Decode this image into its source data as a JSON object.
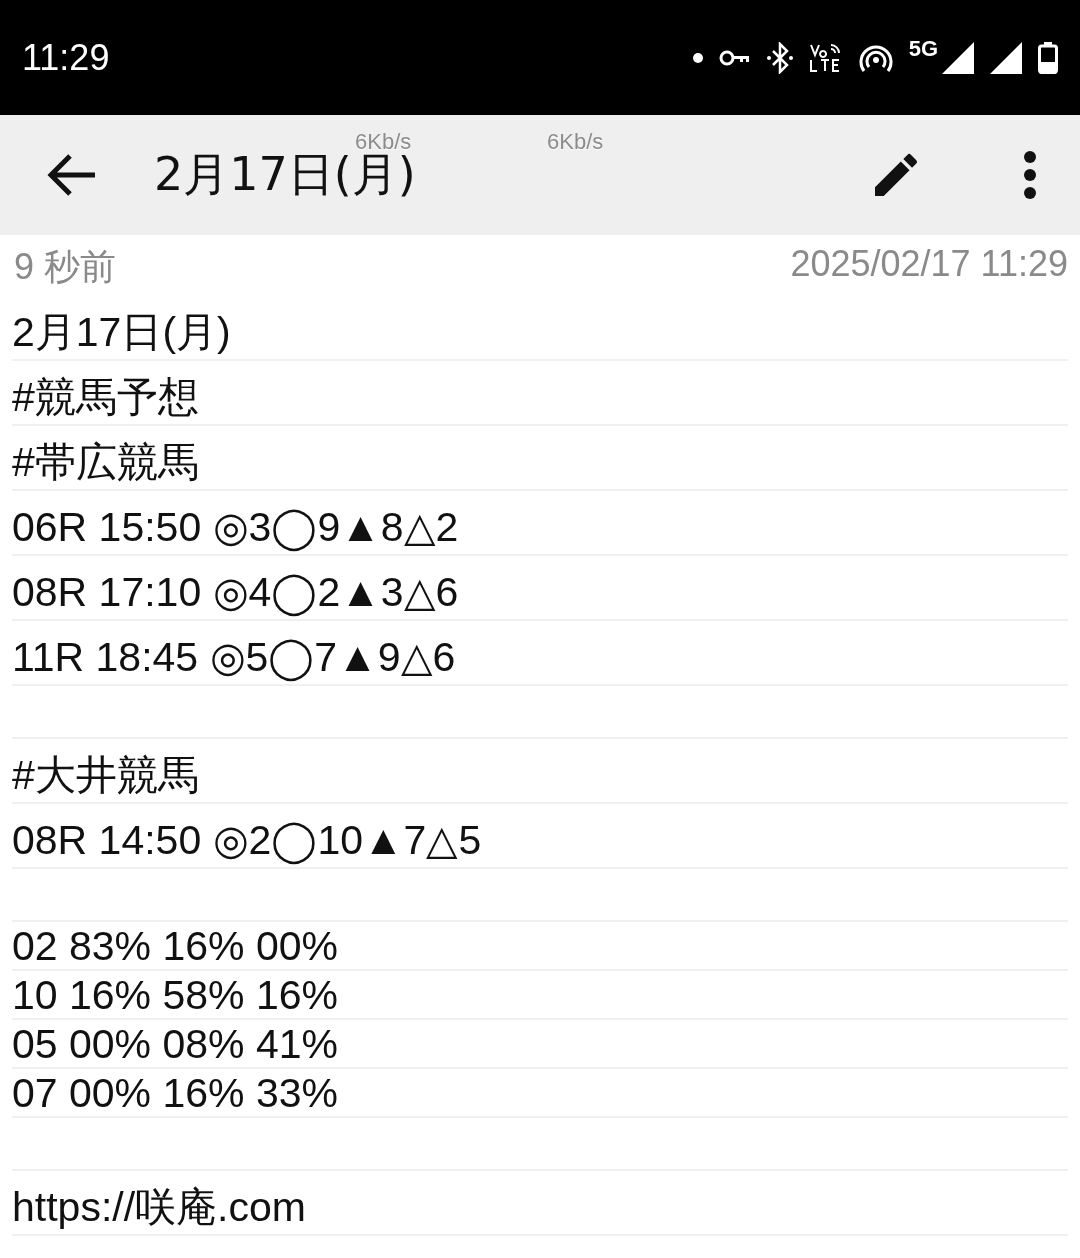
{
  "status_bar": {
    "time": "11:29",
    "network": "5G"
  },
  "speed_overlays": [
    "6Kb/s",
    "6Kb/s"
  ],
  "toolbar": {
    "title": "2月17日(月)"
  },
  "meta": {
    "relative_time": "9 秒前",
    "timestamp": "2025/02/17 11:29"
  },
  "note_lines": [
    {
      "kind": "large",
      "text": "2月17日(月)"
    },
    {
      "kind": "large",
      "text": "#競馬予想"
    },
    {
      "kind": "large",
      "text": "#帯広競馬"
    },
    {
      "kind": "large",
      "text": "06R 15:50 ◎3◯9▲8△2"
    },
    {
      "kind": "large",
      "text": "08R 17:10 ◎4◯2▲3△6"
    },
    {
      "kind": "large",
      "text": "11R 18:45 ◎5◯7▲9△6"
    },
    {
      "kind": "blank"
    },
    {
      "kind": "large",
      "text": "#大井競馬"
    },
    {
      "kind": "large",
      "text": "08R 14:50 ◎2◯10▲7△5"
    },
    {
      "kind": "blank"
    },
    {
      "kind": "compact",
      "text": "02 83% 16% 00%"
    },
    {
      "kind": "compact",
      "text": "10 16% 58% 16%"
    },
    {
      "kind": "compact",
      "text": "05 00% 08% 41%"
    },
    {
      "kind": "compact",
      "text": "07 00% 16% 33%"
    },
    {
      "kind": "blank"
    },
    {
      "kind": "large",
      "text": "https://咲庵.com"
    }
  ]
}
